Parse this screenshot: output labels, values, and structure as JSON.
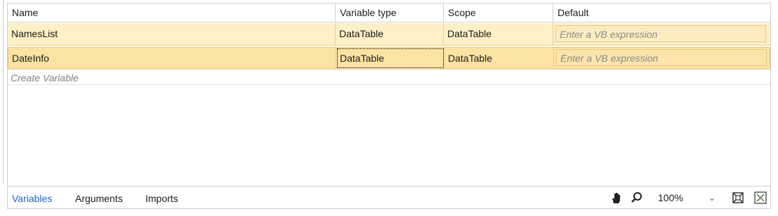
{
  "columns": {
    "name": "Name",
    "variable_type": "Variable type",
    "scope": "Scope",
    "default": "Default"
  },
  "rows": [
    {
      "name": "NamesList",
      "variable_type": "DataTable",
      "scope": "DataTable",
      "default_placeholder": "Enter a VB expression"
    },
    {
      "name": "DateInfo",
      "variable_type": "DataTable",
      "scope": "DataTable",
      "default_placeholder": "Enter a VB expression"
    }
  ],
  "create_variable": "Create Variable",
  "tabs": [
    {
      "label": "Variables",
      "active": true
    },
    {
      "label": "Arguments",
      "active": false
    },
    {
      "label": "Imports",
      "active": false
    }
  ],
  "toolbar": {
    "hand_icon": "hand-icon",
    "search_icon": "magnifier-icon",
    "zoom_value": "100%",
    "fit_icon": "fit-to-screen-icon",
    "fullscreen_icon": "overview-icon"
  },
  "colors": {
    "row_selected": "#fce3a3",
    "row_highlight": "#fdefc6",
    "active_tab": "#1f66c1"
  }
}
